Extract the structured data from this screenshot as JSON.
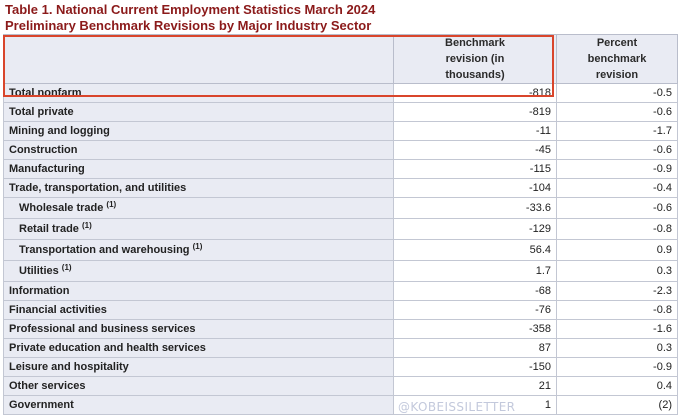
{
  "title": {
    "line1": "Table 1. National Current Employment Statistics March 2024",
    "line2": "Preliminary Benchmark Revisions by Major Industry Sector"
  },
  "headers": {
    "label": "",
    "revision": "Benchmark revision (in thousands)",
    "percent": "Percent benchmark revision"
  },
  "rows": [
    {
      "label": "Total nonfarm",
      "revision": "-818",
      "percent": "-0.5"
    },
    {
      "label": "Total private",
      "revision": "-819",
      "percent": "-0.6"
    },
    {
      "label": "Mining and logging",
      "revision": "-11",
      "percent": "-1.7"
    },
    {
      "label": "Construction",
      "revision": "-45",
      "percent": "-0.6"
    },
    {
      "label": "Manufacturing",
      "revision": "-115",
      "percent": "-0.9"
    },
    {
      "label": "Trade, transportation, and utilities",
      "revision": "-104",
      "percent": "-0.4"
    },
    {
      "label": "Wholesale trade",
      "footnote": "(1)",
      "revision": "-33.6",
      "percent": "-0.6"
    },
    {
      "label": "Retail trade",
      "footnote": "(1)",
      "revision": "-129",
      "percent": "-0.8"
    },
    {
      "label": "Transportation and warehousing",
      "footnote": "(1)",
      "revision": "56.4",
      "percent": "0.9"
    },
    {
      "label": "Utilities",
      "footnote": "(1)",
      "revision": "1.7",
      "percent": "0.3"
    },
    {
      "label": "Information",
      "revision": "-68",
      "percent": "-2.3"
    },
    {
      "label": "Financial activities",
      "revision": "-76",
      "percent": "-0.8"
    },
    {
      "label": "Professional and business services",
      "revision": "-358",
      "percent": "-1.6"
    },
    {
      "label": "Private education and health services",
      "revision": "87",
      "percent": "0.3"
    },
    {
      "label": "Leisure and hospitality",
      "revision": "-150",
      "percent": "-0.9"
    },
    {
      "label": "Other services",
      "revision": "21",
      "percent": "0.4"
    },
    {
      "label": "Government",
      "revision": "1",
      "percent": "(2)"
    }
  ],
  "watermark": "@KOBEISSILETTER",
  "colors": {
    "title": "#8b1a1a",
    "highlight": "#d9452b",
    "label_bg": "#e9ebf3"
  }
}
